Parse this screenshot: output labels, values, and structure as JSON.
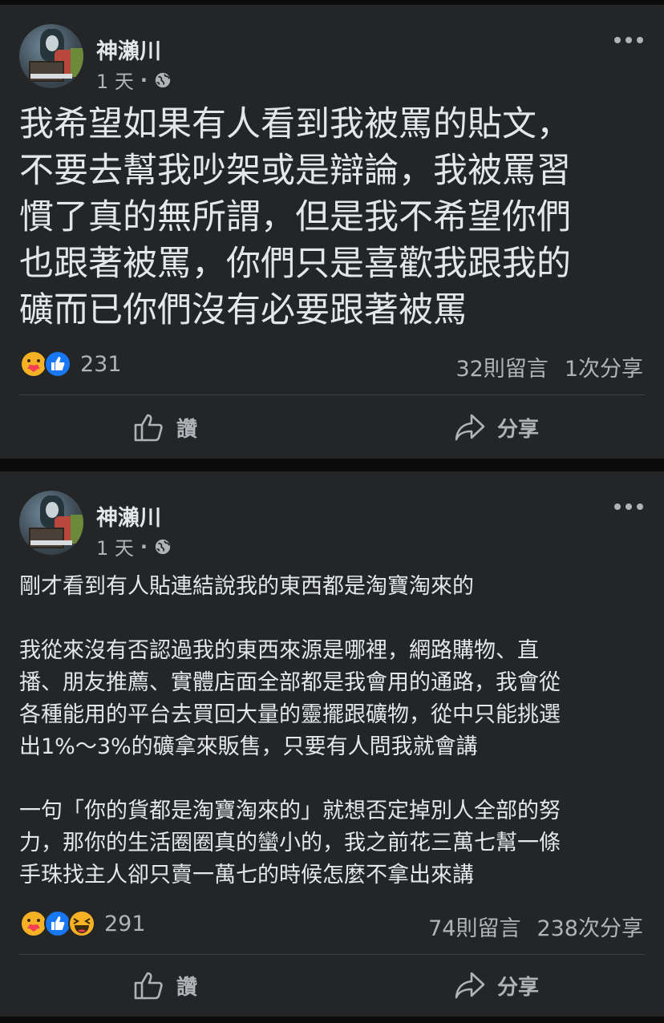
{
  "posts": [
    {
      "author": "神瀨川",
      "time": "1 天",
      "separator": "·",
      "text_lines": [
        "我希望如果有人看到我被罵的貼文，",
        "不要去幫我吵架或是辯論，我被罵習",
        "慣了真的無所謂，但是我不希望你們",
        "也跟著被罵，你們只是喜歡我跟我的",
        "礦而已你們沒有必要跟著被罵"
      ],
      "reaction_icons": [
        "care-icon",
        "like-icon"
      ],
      "reaction_count": "231",
      "comments": "32則留言",
      "shares": "1次分享",
      "like_label": "讚",
      "share_label": "分享"
    },
    {
      "author": "神瀨川",
      "time": "1 天",
      "separator": "·",
      "paragraphs": [
        [
          "剛才看到有人貼連結說我的東西都是淘寶淘來的"
        ],
        [
          "我從來沒有否認過我的東西來源是哪裡，網路購物、直",
          "播、朋友推薦、實體店面全部都是我會用的通路，我會從",
          "各種能用的平台去買回大量的靈擺跟礦物，從中只能挑選",
          "出1%～3%的礦拿來販售，只要有人問我就會講"
        ],
        [
          "一句「你的貨都是淘寶淘來的」就想否定掉別人全部的努",
          "力，那你的生活圈圈真的蠻小的，我之前花三萬七幫一條",
          "手珠找主人卻只賣一萬七的時候怎麼不拿出來講"
        ]
      ],
      "reaction_icons": [
        "care-icon",
        "like-icon",
        "haha-icon"
      ],
      "reaction_count": "291",
      "comments": "74則留言",
      "shares": "238次分享",
      "like_label": "讚",
      "share_label": "分享"
    }
  ],
  "colors": {
    "card_bg": "#242526",
    "page_bg": "#0b0b0c",
    "primary_text": "#e4e6eb",
    "secondary_text": "#b0b3b8",
    "like_blue": "#1877f2",
    "care_yellow": "#f7b125"
  }
}
